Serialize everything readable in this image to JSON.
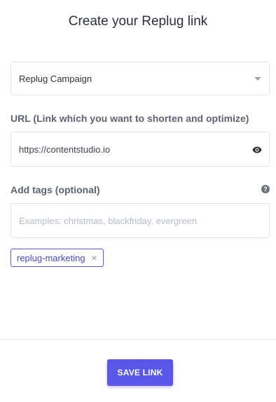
{
  "dialog": {
    "title": "Create your Replug link"
  },
  "campaign_select": {
    "selected": "Replug Campaign"
  },
  "url_field": {
    "label": "URL (Link which you want to shorten and optimize)",
    "value": "https://contentstudio.io",
    "icon": "eye-icon"
  },
  "tags_field": {
    "label": "Add tags (optional)",
    "placeholder": "Examples: christmas, blackfriday, evergreen",
    "help_icon": "question-circle-icon",
    "help_glyph": "?",
    "tags": [
      {
        "label": "replug-marketing",
        "remove_glyph": "×"
      }
    ]
  },
  "footer": {
    "save_label": "SAVE LINK"
  },
  "colors": {
    "accent": "#5a56e9",
    "border": "#dfe3e8",
    "label": "#5b6472"
  }
}
